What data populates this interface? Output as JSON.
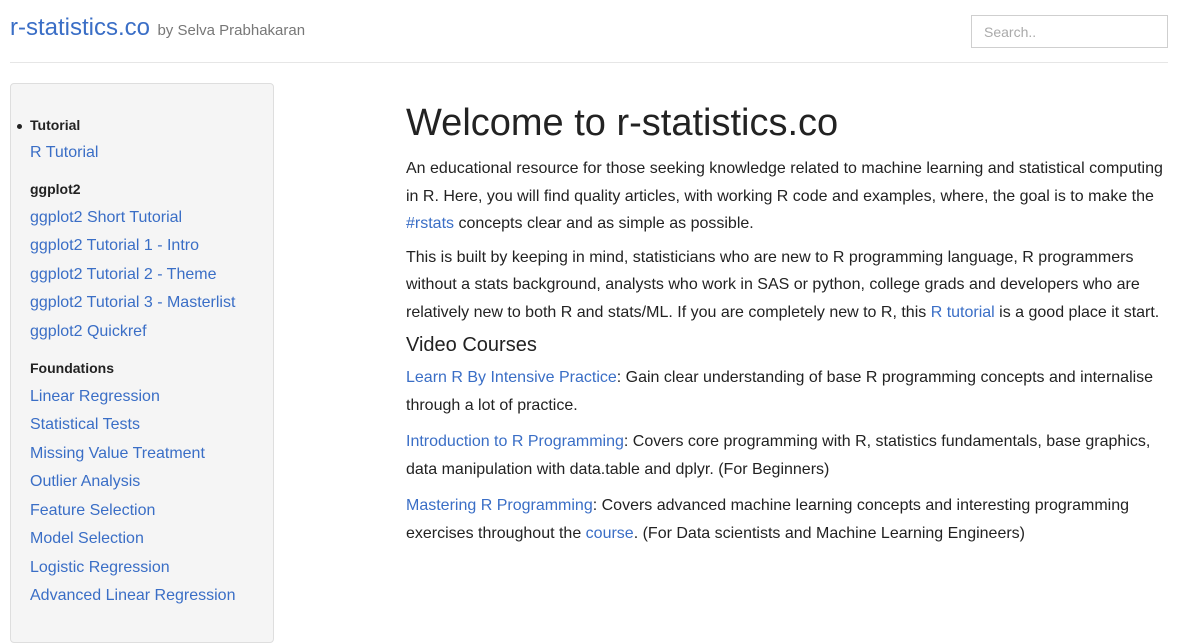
{
  "header": {
    "logo": "r-statistics.co",
    "byline": "by Selva Prabhakaran",
    "search_placeholder": "Search.."
  },
  "sidebar": {
    "groups": [
      {
        "heading": "Tutorial",
        "items": [
          "R Tutorial"
        ]
      },
      {
        "heading": "ggplot2",
        "items": [
          "ggplot2 Short Tutorial",
          "ggplot2 Tutorial 1 - Intro",
          "ggplot2 Tutorial 2 - Theme",
          "ggplot2 Tutorial 3 - Masterlist",
          "ggplot2 Quickref"
        ]
      },
      {
        "heading": "Foundations",
        "items": [
          "Linear Regression",
          "Statistical Tests",
          "Missing Value Treatment",
          "Outlier Analysis",
          "Feature Selection",
          "Model Selection",
          "Logistic Regression",
          "Advanced Linear Regression"
        ]
      }
    ]
  },
  "main": {
    "title": "Welcome to r-statistics.co",
    "intro": {
      "text_before": "An educational resource for those seeking knowledge related to machine learning and statistical computing in R. Here, you will find quality articles, with working R code and examples, where, the goal is to make the ",
      "link": "#rstats",
      "text_after": " concepts clear and as simple as possible."
    },
    "para2": {
      "text_before": "This is built by keeping in mind, statisticians who are new to R programming language, R programmers without a stats background, analysts who work in SAS or python, college grads and developers who are relatively new to both R and stats/ML. If you are completely new to R, this ",
      "link": "R tutorial",
      "text_after": " is a good place it start."
    },
    "video_heading": "Video Courses",
    "courses": [
      {
        "link": "Learn R By Intensive Practice",
        "text": ": Gain clear understanding of base R programming concepts and internalise through a lot of practice."
      },
      {
        "link": "Introduction to R Programming",
        "text": ": Covers core programming with R, statistics fundamentals, base graphics, data manipulation with data.table and dplyr. (For Beginners)"
      },
      {
        "link": "Mastering R Programming",
        "text": ": Covers advanced machine learning concepts and interesting programming exercises throughout the ",
        "link2": "course",
        "text2": ". (For Data scientists and Machine Learning Engineers)"
      }
    ]
  }
}
